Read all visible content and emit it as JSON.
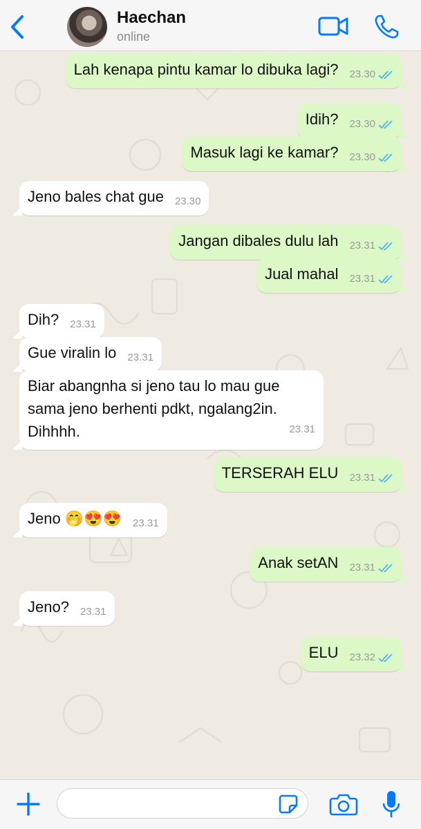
{
  "header": {
    "contact_name": "Haechan",
    "status": "online",
    "icons": {
      "back": "chevron-left-icon",
      "video": "video-call-icon",
      "call": "phone-icon"
    }
  },
  "colors": {
    "accent": "#007aff",
    "outgoing_bubble": "#dcf8c6",
    "incoming_bubble": "#ffffff",
    "chat_background": "#efeae2",
    "read_ticks": "#4fb6ec"
  },
  "messages": [
    {
      "direction": "out",
      "text": "Lah kenapa pintu kamar lo dibuka lagi?",
      "time": "23.30",
      "read": true
    },
    {
      "direction": "out",
      "text": "Idih?",
      "time": "23.30",
      "read": true
    },
    {
      "direction": "out",
      "text": "Masuk lagi ke kamar?",
      "time": "23.30",
      "read": true
    },
    {
      "direction": "in",
      "text": "Jeno bales chat gue",
      "time": "23.30"
    },
    {
      "direction": "out",
      "text": "Jangan dibales dulu lah",
      "time": "23.31",
      "read": true
    },
    {
      "direction": "out",
      "text": "Jual mahal",
      "time": "23.31",
      "read": true
    },
    {
      "direction": "in",
      "text": "Dih?",
      "time": "23.31"
    },
    {
      "direction": "in",
      "text": "Gue viralin lo",
      "time": "23.31"
    },
    {
      "direction": "in",
      "text": "Biar abangnha si jeno tau lo mau gue sama jeno berhenti pdkt, ngalang2in. Dihhhh.",
      "time": "23.31"
    },
    {
      "direction": "out",
      "text": "TERSERAH ELU",
      "time": "23.31",
      "read": true
    },
    {
      "direction": "in",
      "text": "Jeno 🤭😍😍",
      "time": "23.31"
    },
    {
      "direction": "out",
      "text": "Anak setAN",
      "time": "23.31",
      "read": true
    },
    {
      "direction": "in",
      "text": "Jeno?",
      "time": "23.31"
    },
    {
      "direction": "out",
      "text": "ELU",
      "time": "23.32",
      "read": true
    }
  ],
  "input_bar": {
    "placeholder": "",
    "value": "",
    "icons": {
      "add": "plus-icon",
      "sticker": "sticker-icon",
      "camera": "camera-icon",
      "mic": "microphone-icon"
    }
  }
}
